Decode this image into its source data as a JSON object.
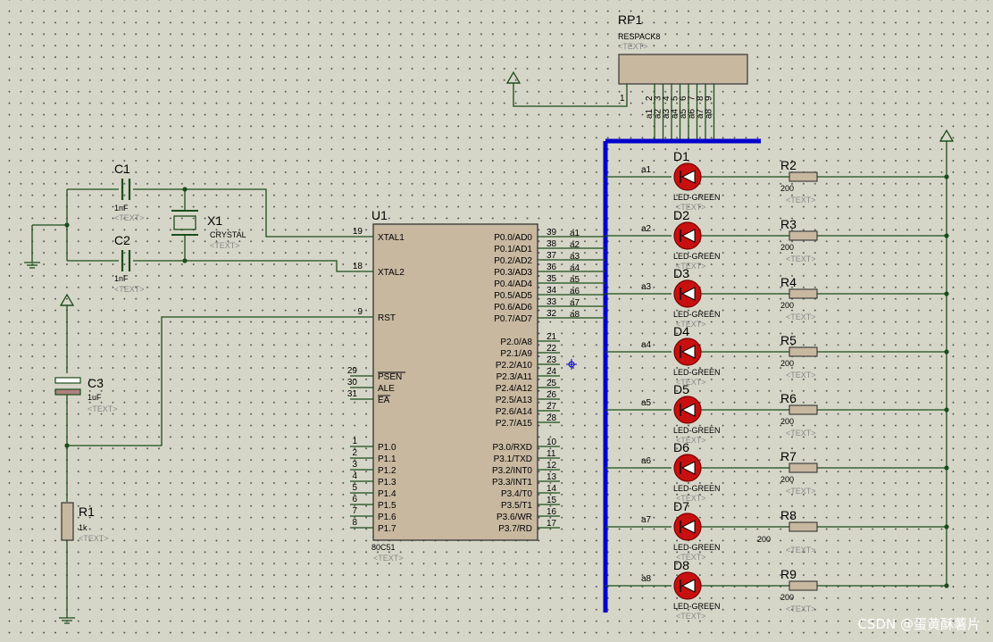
{
  "rp1": {
    "ref": "RP1",
    "value": "RESPACK8",
    "text": "<TEXT>",
    "pins": [
      "1",
      "2",
      "3",
      "4",
      "5",
      "6",
      "7",
      "8",
      "9"
    ],
    "nets": [
      "a1",
      "a2",
      "a3",
      "a4",
      "a5",
      "a6",
      "a7",
      "a8"
    ]
  },
  "c1": {
    "ref": "C1",
    "value": "1nF",
    "text": "<TEXT>"
  },
  "c2": {
    "ref": "C2",
    "value": "1nF",
    "text": "<TEXT>"
  },
  "x1": {
    "ref": "X1",
    "value": "CRYSTAL",
    "text": "<TEXT>"
  },
  "c3": {
    "ref": "C3",
    "value": "1uF",
    "text": "<TEXT>"
  },
  "r1": {
    "ref": "R1",
    "value": "1k",
    "text": "<TEXT>"
  },
  "u1": {
    "ref": "U1",
    "value": "80C51",
    "text": "<TEXT>",
    "left_pins": [
      {
        "num": "19",
        "name": "XTAL1"
      },
      {
        "num": "18",
        "name": "XTAL2"
      },
      {
        "num": "9",
        "name": "RST"
      },
      {
        "num": "29",
        "name": "PSEN"
      },
      {
        "num": "30",
        "name": "ALE"
      },
      {
        "num": "31",
        "name": "EA"
      },
      {
        "num": "1",
        "name": "P1.0"
      },
      {
        "num": "2",
        "name": "P1.1"
      },
      {
        "num": "3",
        "name": "P1.2"
      },
      {
        "num": "4",
        "name": "P1.3"
      },
      {
        "num": "5",
        "name": "P1.4"
      },
      {
        "num": "6",
        "name": "P1.5"
      },
      {
        "num": "7",
        "name": "P1.6"
      },
      {
        "num": "8",
        "name": "P1.7"
      }
    ],
    "right_pins": [
      {
        "num": "39",
        "name": "P0.0/AD0",
        "net": "a1"
      },
      {
        "num": "38",
        "name": "P0.1/AD1",
        "net": "a2"
      },
      {
        "num": "37",
        "name": "P0.2/AD2",
        "net": "a3"
      },
      {
        "num": "36",
        "name": "P0.3/AD3",
        "net": "a4"
      },
      {
        "num": "35",
        "name": "P0.4/AD4",
        "net": "a5"
      },
      {
        "num": "34",
        "name": "P0.5/AD5",
        "net": "a6"
      },
      {
        "num": "33",
        "name": "P0.6/AD6",
        "net": "a7"
      },
      {
        "num": "32",
        "name": "P0.7/AD7",
        "net": "a8"
      },
      {
        "num": "21",
        "name": "P2.0/A8"
      },
      {
        "num": "22",
        "name": "P2.1/A9"
      },
      {
        "num": "23",
        "name": "P2.2/A10"
      },
      {
        "num": "24",
        "name": "P2.3/A11"
      },
      {
        "num": "25",
        "name": "P2.4/A12"
      },
      {
        "num": "26",
        "name": "P2.5/A13"
      },
      {
        "num": "27",
        "name": "P2.6/A14"
      },
      {
        "num": "28",
        "name": "P2.7/A15"
      },
      {
        "num": "10",
        "name": "P3.0/RXD"
      },
      {
        "num": "11",
        "name": "P3.1/TXD"
      },
      {
        "num": "12",
        "name": "P3.2/INT0"
      },
      {
        "num": "13",
        "name": "P3.3/INT1"
      },
      {
        "num": "14",
        "name": "P3.4/T0"
      },
      {
        "num": "15",
        "name": "P3.5/T1"
      },
      {
        "num": "16",
        "name": "P3.6/WR"
      },
      {
        "num": "17",
        "name": "P3.7/RD"
      }
    ]
  },
  "leds": [
    {
      "ref": "D1",
      "value": "LED-GREEN",
      "text": "<TEXT>",
      "net": "a1"
    },
    {
      "ref": "D2",
      "value": "LED-GREEN",
      "text": "<TEXT>",
      "net": "a2"
    },
    {
      "ref": "D3",
      "value": "LED-GREEN",
      "text": "<TEXT>",
      "net": "a3"
    },
    {
      "ref": "D4",
      "value": "LED-GREEN",
      "text": "<TEXT>",
      "net": "a4"
    },
    {
      "ref": "D5",
      "value": "LED-GREEN",
      "text": "<TEXT>",
      "net": "a5"
    },
    {
      "ref": "D6",
      "value": "LED-GREEN",
      "text": "<TEXT>",
      "net": "a6"
    },
    {
      "ref": "D7",
      "value": "LED-GREEN",
      "text": "<TEXT>",
      "net": "a7"
    },
    {
      "ref": "D8",
      "value": "LED-GREEN",
      "text": "<TEXT>",
      "net": "a8"
    }
  ],
  "resistors": [
    {
      "ref": "R2",
      "value": "200",
      "text": "<TEXT>"
    },
    {
      "ref": "R3",
      "value": "200",
      "text": "<TEXT>"
    },
    {
      "ref": "R4",
      "value": "200",
      "text": "<TEXT>"
    },
    {
      "ref": "R5",
      "value": "200",
      "text": "<TEXT>"
    },
    {
      "ref": "R6",
      "value": "200",
      "text": "<TEXT>"
    },
    {
      "ref": "R7",
      "value": "200",
      "text": "<TEXT>"
    },
    {
      "ref": "R8",
      "value": "200",
      "text": "<TEXT>"
    },
    {
      "ref": "R9",
      "value": "200",
      "text": "<TEXT>"
    }
  ],
  "watermark": "CSDN @蛋黄酥薯片",
  "colors": {
    "wire": "#1a4d1a",
    "bus": "#0000cc",
    "body": "#c8b8a0",
    "led": "#c81010",
    "background": "#d6d6c8"
  }
}
